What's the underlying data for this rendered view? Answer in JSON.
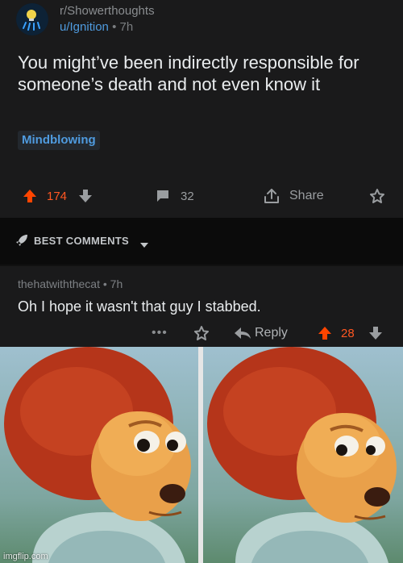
{
  "post": {
    "subreddit": "r/Showerthoughts",
    "author": "u/Ignition",
    "separator": "•",
    "time": "7h",
    "title": "You might’ve been indirectly responsible for someone’s death and not even know it",
    "flair": "Mindblowing",
    "score": "174",
    "comments": "32",
    "share_label": "Share"
  },
  "sortbar": {
    "label": "BEST COMMENTS"
  },
  "comment": {
    "author": "thehatwiththecat",
    "separator": "•",
    "time": "7h",
    "body": "Oh I hope it wasn't that guy I stabbed.",
    "more_label": "•••",
    "reply_label": "Reply",
    "score": "28"
  },
  "meme": {
    "watermark": "imgflip.com"
  },
  "colors": {
    "upvote": "#ff4500",
    "link_blue": "#4f9bdf",
    "background": "#1a1a1b"
  },
  "icons": {
    "subreddit_avatar": "lightbulb-shower-icon",
    "upvote": "arrow-up-icon",
    "downvote": "arrow-down-icon",
    "comment": "comment-bubble-icon",
    "share": "share-icon",
    "award": "award-icon",
    "sort": "rocket-icon",
    "reply": "reply-arrow-icon"
  }
}
